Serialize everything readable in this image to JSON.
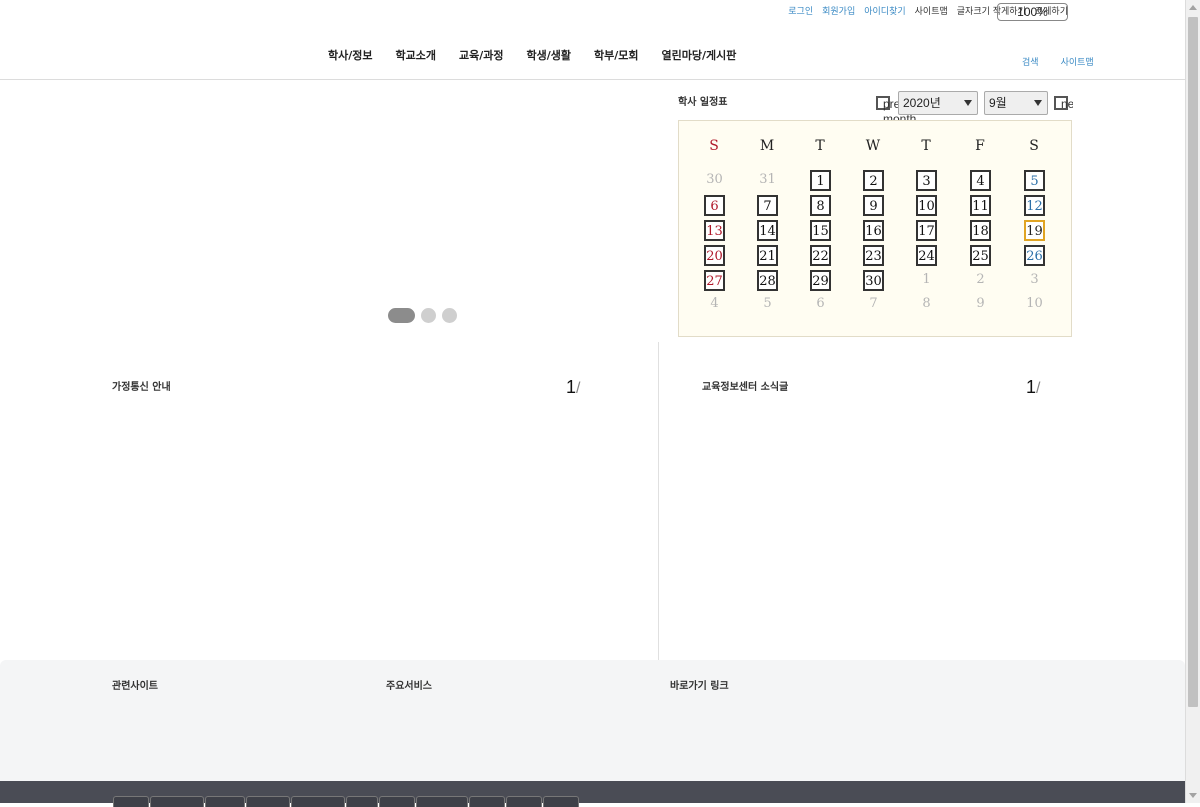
{
  "header": {
    "util_links": [
      {
        "label": "로그인",
        "style": "link"
      },
      {
        "label": "회원가입",
        "style": "link"
      },
      {
        "label": "아이디찾기",
        "style": "link"
      },
      {
        "label": "사이트맵",
        "style": "dark"
      },
      {
        "label": "글자크기 작게하기",
        "style": "dark"
      },
      {
        "label": "크게하기",
        "style": "dark"
      }
    ],
    "zoom_value": "100%",
    "nav": [
      "학사/정보",
      "학교소개",
      "교육/과정",
      "학생/생활",
      "학부/모회",
      "열린마당/게시판"
    ],
    "right_links": [
      "검색",
      "사이트맵"
    ]
  },
  "slider": {
    "dot_count": 3,
    "active_index": 0
  },
  "calendar": {
    "title": "학사 일정표",
    "prev_label": "prev month",
    "next_label": "next month",
    "year_select": "2020년",
    "month_select": "9월",
    "weekdays": [
      "S",
      "M",
      "T",
      "W",
      "T",
      "F",
      "S"
    ],
    "today": 19,
    "weeks": [
      [
        {
          "d": "30",
          "o": true
        },
        {
          "d": "31",
          "o": true
        },
        {
          "d": "1"
        },
        {
          "d": "2"
        },
        {
          "d": "3"
        },
        {
          "d": "4"
        },
        {
          "d": "5"
        }
      ],
      [
        {
          "d": "6"
        },
        {
          "d": "7"
        },
        {
          "d": "8"
        },
        {
          "d": "9"
        },
        {
          "d": "10"
        },
        {
          "d": "11"
        },
        {
          "d": "12"
        }
      ],
      [
        {
          "d": "13"
        },
        {
          "d": "14"
        },
        {
          "d": "15"
        },
        {
          "d": "16"
        },
        {
          "d": "17"
        },
        {
          "d": "18"
        },
        {
          "d": "19"
        }
      ],
      [
        {
          "d": "20"
        },
        {
          "d": "21"
        },
        {
          "d": "22"
        },
        {
          "d": "23"
        },
        {
          "d": "24"
        },
        {
          "d": "25"
        },
        {
          "d": "26"
        }
      ],
      [
        {
          "d": "27"
        },
        {
          "d": "28"
        },
        {
          "d": "29"
        },
        {
          "d": "30"
        },
        {
          "d": "1",
          "o": true
        },
        {
          "d": "2",
          "o": true
        },
        {
          "d": "3",
          "o": true
        }
      ],
      [
        {
          "d": "4",
          "o": true
        },
        {
          "d": "5",
          "o": true
        },
        {
          "d": "6",
          "o": true
        },
        {
          "d": "7",
          "o": true
        },
        {
          "d": "8",
          "o": true
        },
        {
          "d": "9",
          "o": true
        },
        {
          "d": "10",
          "o": true
        }
      ]
    ]
  },
  "panels": {
    "left": {
      "title": "가정통신 안내",
      "page": "1",
      "sep": "/"
    },
    "right": {
      "title": "교육정보센터 소식글",
      "page": "1",
      "sep": "/"
    }
  },
  "footer": {
    "titles": [
      "관련사이트",
      "주요서비스",
      "바로가기 링크"
    ],
    "tab_count": 11
  },
  "colors": {
    "accent_link": "#3a8ac4",
    "sunday": "#b0182a",
    "saturday": "#2a6fa8",
    "today_border": "#e0a423",
    "calendar_bg": "#fffdf2",
    "footer_bar": "#4a4c55"
  }
}
